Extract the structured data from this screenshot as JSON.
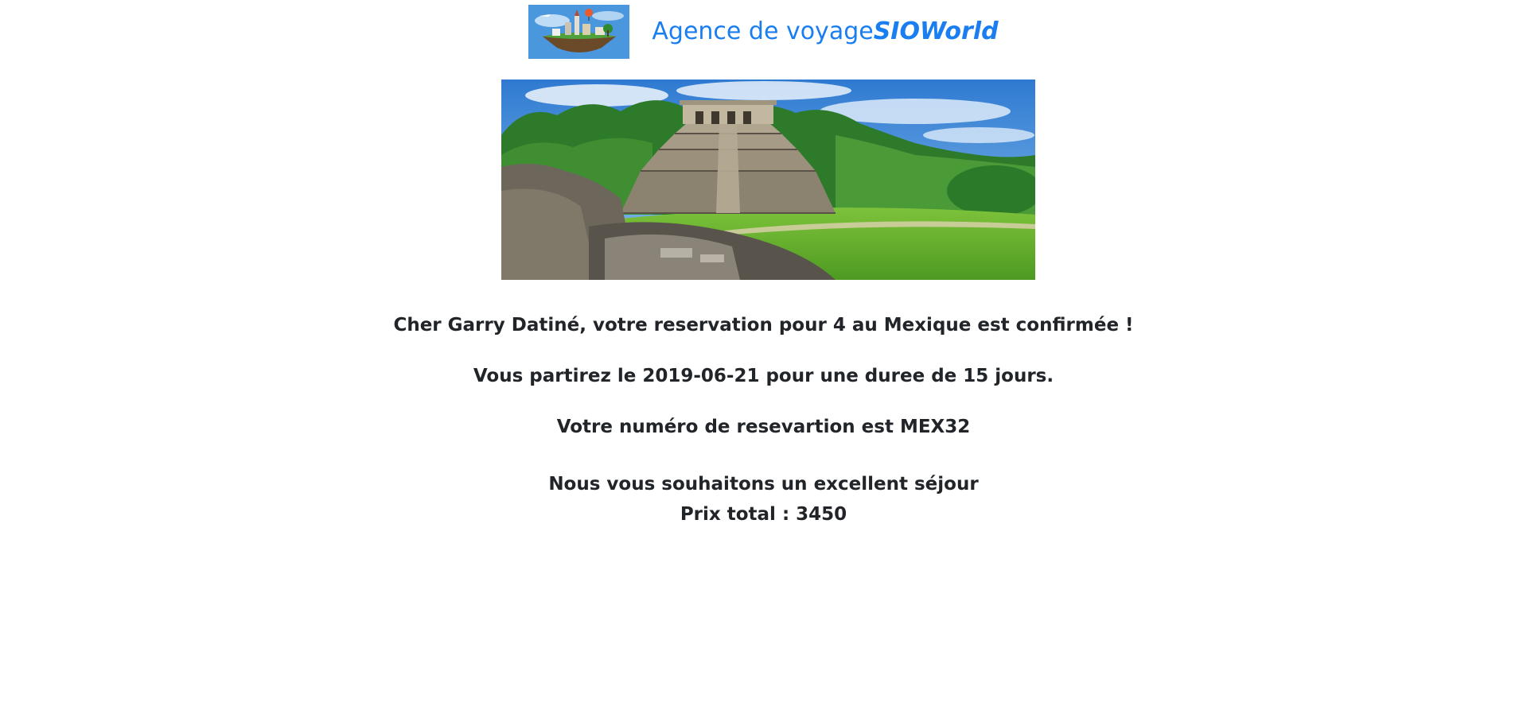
{
  "header": {
    "logo": {
      "alt": "SIOWorld travel agency logo"
    },
    "title_plain": "Agence de voyage",
    "title_brand": "SIOWorld"
  },
  "banner": {
    "alt": "Mayan pyramid temple ruins in the jungle, Mexico"
  },
  "confirmation": {
    "greeting": "Cher Garry Datiné, votre reservation pour 4 au Mexique est confirmée !",
    "departure": "Vous partirez le 2019-06-21 pour une duree de 15 jours.",
    "reference": "Votre numéro de resevartion est MEX32",
    "wish": "Nous vous souhaitons un excellent séjour",
    "total": "Prix total : 3450"
  },
  "colors": {
    "brand_blue": "#1a7ef0",
    "text": "#212529",
    "background": "#ffffff"
  }
}
